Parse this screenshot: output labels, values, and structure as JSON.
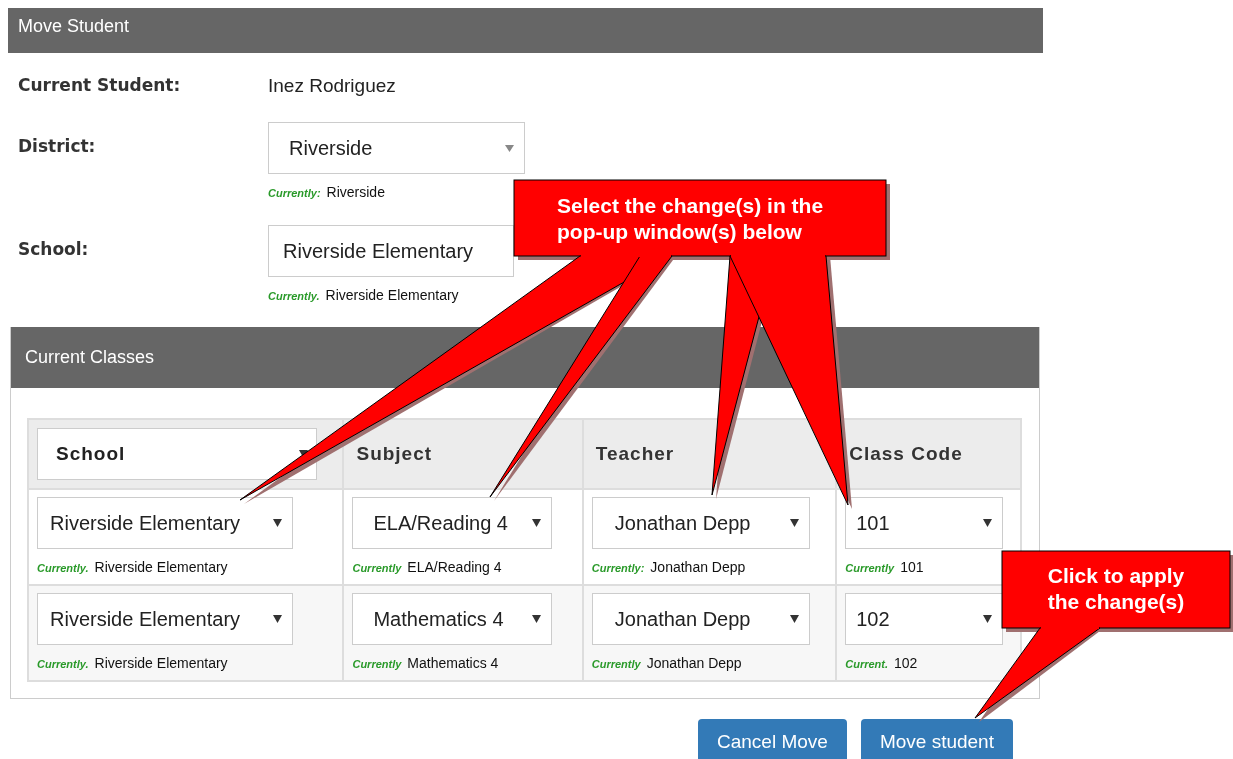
{
  "panel": {
    "title": "Move Student"
  },
  "fields": [
    {
      "label": "Current Student:",
      "kind": "text",
      "value": "Inez Rodriguez"
    },
    {
      "label": "District:",
      "kind": "select",
      "value": "Riverside",
      "current_label": "Currently:",
      "current": "Riverside"
    },
    {
      "label": "School:",
      "kind": "select",
      "value": "Riverside Elementary",
      "current_label": "Currently.",
      "current": "Riverside Elementary"
    }
  ],
  "classes": {
    "title": "Current Classes",
    "columns": [
      {
        "label": "School",
        "kind": "select"
      },
      {
        "label": "Subject",
        "kind": "text"
      },
      {
        "label": "Teacher",
        "kind": "text"
      },
      {
        "label": "Class Code",
        "kind": "text"
      }
    ],
    "rows": [
      [
        {
          "value": "Riverside Elementary",
          "current_label": "Currently.",
          "current": "Riverside Elementary"
        },
        {
          "value": "ELA/Reading 4",
          "current_label": "Currently",
          "current": "ELA/Reading 4"
        },
        {
          "value": "Jonathan Depp",
          "current_label": "Currently:",
          "current": "Jonathan Depp"
        },
        {
          "value": "101",
          "current_label": "Currently",
          "current": "101"
        }
      ],
      [
        {
          "value": "Riverside Elementary",
          "current_label": "Currently.",
          "current": "Riverside Elementary"
        },
        {
          "value": "Mathematics 4",
          "current_label": "Currently",
          "current": "Mathematics 4"
        },
        {
          "value": "Jonathan Depp",
          "current_label": "Currently",
          "current": "Jonathan Depp"
        },
        {
          "value": "102",
          "current_label": "Current.",
          "current": "102"
        }
      ]
    ]
  },
  "buttons": [
    "Cancel Move",
    "Move student"
  ],
  "callouts": [
    {
      "lines": [
        "Select the change(s) in the",
        "pop-up window(s) below"
      ]
    },
    {
      "lines": [
        "Click to apply",
        "the change(s)"
      ]
    }
  ]
}
